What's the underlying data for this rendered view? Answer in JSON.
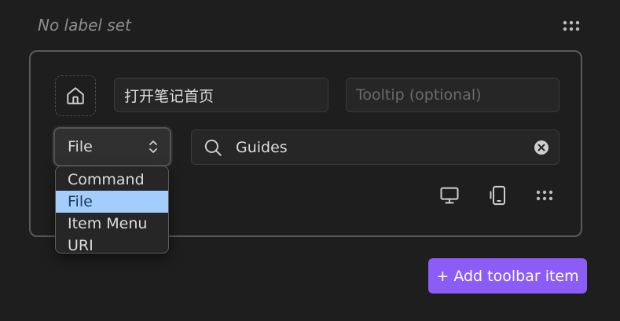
{
  "header": {
    "label": "No label set",
    "more_icon": "dots-grid-icon"
  },
  "item": {
    "icon": "home-icon",
    "label_value": "打开笔记首页",
    "tooltip_placeholder": "Tooltip (optional)",
    "type_select": {
      "value": "File",
      "icon": "chevron-up-down-icon"
    },
    "search": {
      "icon": "search-icon",
      "value": "Guides",
      "clear_icon": "x-circle-icon"
    },
    "tools": [
      {
        "name": "desktop-icon"
      },
      {
        "name": "mobile-icon"
      },
      {
        "name": "more-options-icon"
      }
    ]
  },
  "dropdown": {
    "options": [
      {
        "label": "Command",
        "selected": false
      },
      {
        "label": "File",
        "selected": true
      },
      {
        "label": "Item Menu",
        "selected": false
      },
      {
        "label": "URI",
        "selected": false
      }
    ]
  },
  "actions": {
    "add_label": "+ Add toolbar item"
  },
  "colors": {
    "accent": "#8b5cf6",
    "selected_option": "#a3cdfc",
    "background": "#1e1e1e"
  }
}
